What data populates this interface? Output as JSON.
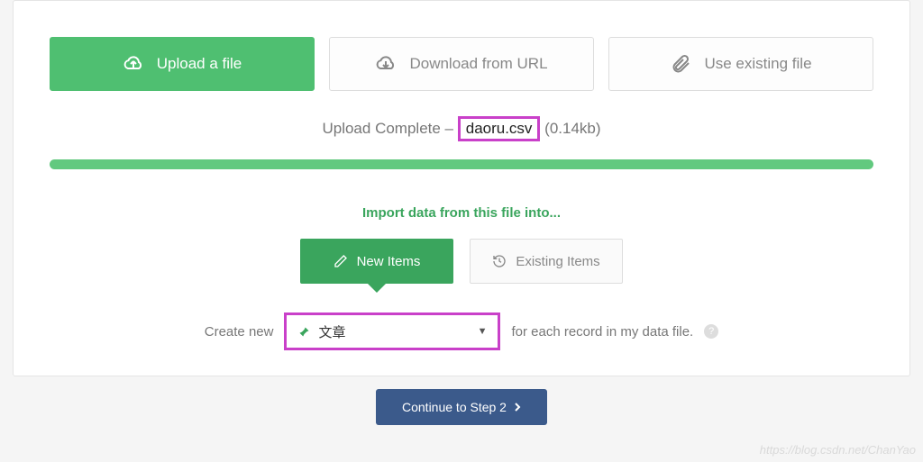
{
  "tabs": {
    "upload": "Upload a file",
    "download": "Download from URL",
    "existing": "Use existing file"
  },
  "upload_status": {
    "prefix": "Upload Complete – ",
    "filename": "daoru.csv",
    "size": " (0.14kb)"
  },
  "section_title": "Import data from this file into...",
  "sub_tabs": {
    "new_items": "New Items",
    "existing_items": "Existing Items"
  },
  "create_row": {
    "prefix": "Create new",
    "selected": "文章",
    "suffix": "for each record in my data file."
  },
  "continue_label": "Continue to Step 2",
  "watermark": "https://blog.csdn.net/ChanYao"
}
